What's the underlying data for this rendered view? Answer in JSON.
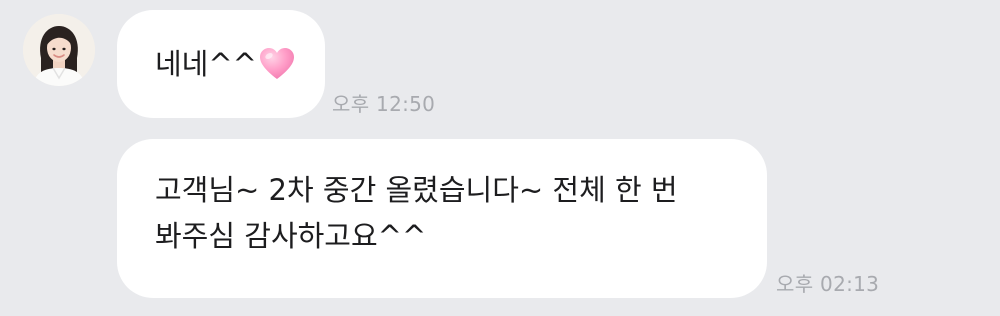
{
  "messages": [
    {
      "lines": [
        "네네^^"
      ],
      "emoji": "pink-heart",
      "time": "오후 12:50"
    },
    {
      "lines": [
        "고객님~ 2차 중간 올렸습니다~ 전체 한 번",
        "봐주심 감사하고요^^"
      ],
      "time": "오후 02:13"
    }
  ],
  "colors": {
    "background": "#e9eaed",
    "bubble": "#ffffff",
    "heart": "#ff9ec8",
    "timestamp": "#a8aaaf"
  }
}
